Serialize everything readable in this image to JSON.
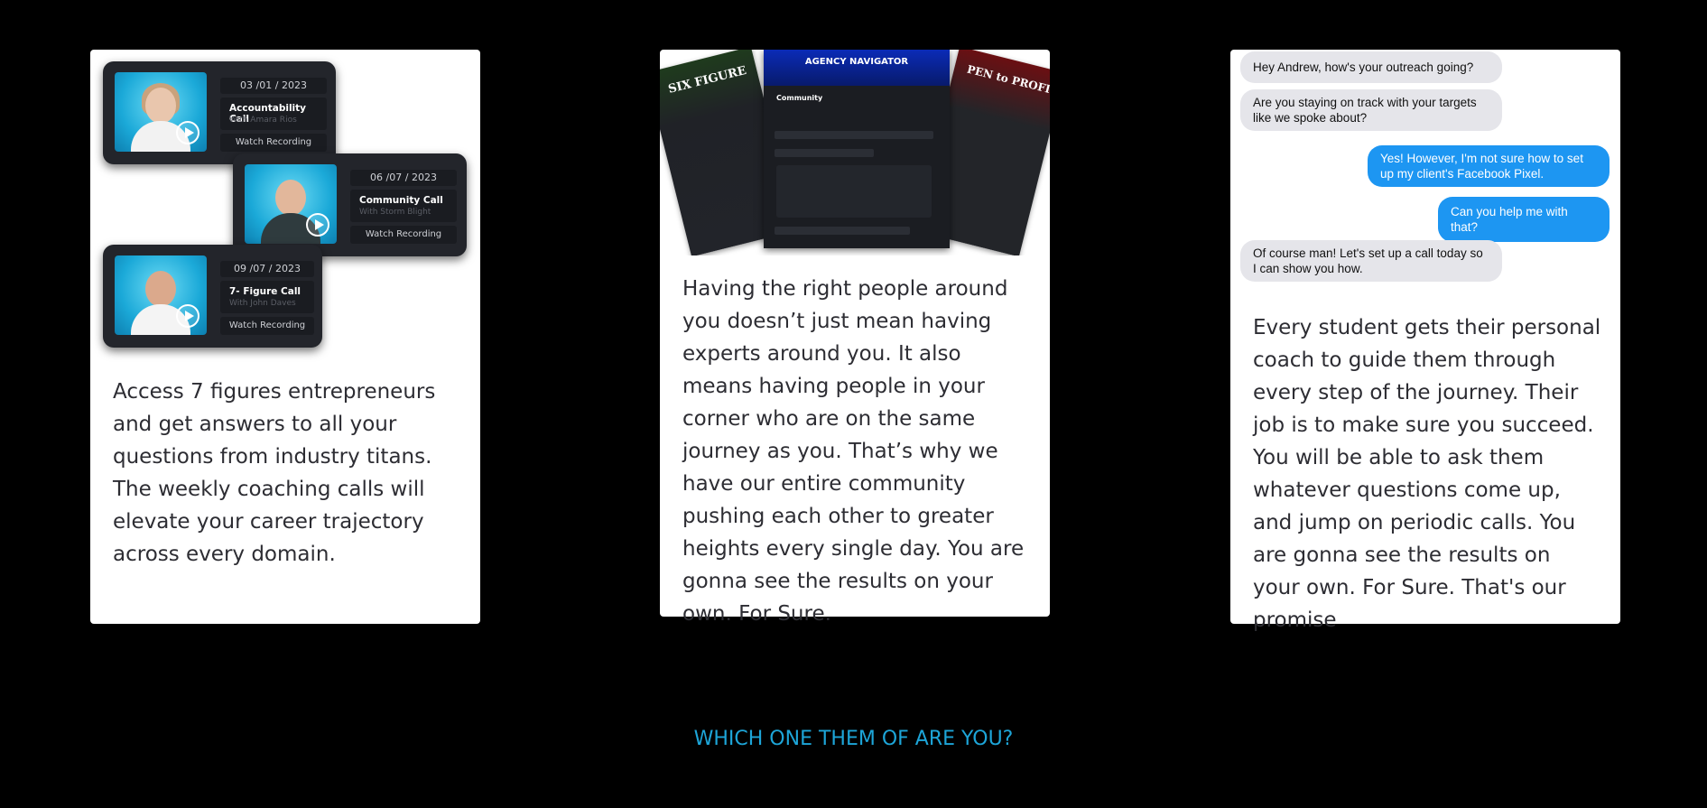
{
  "cards": [
    {
      "text": "Access 7 figures entrepreneurs and get answers to all your questions from industry titans. The weekly coaching calls will elevate your career trajectory across every domain.",
      "recordings": [
        {
          "date": "03 /01 / 2023",
          "title": "Accountability Call",
          "with": "With Amara Rios",
          "watch": "Watch Recording"
        },
        {
          "date": "06 /07 / 2023",
          "title": "Community Call",
          "with": "With Storm Blight",
          "watch": "Watch Recording"
        },
        {
          "date": "09 /07 / 2023",
          "title": "7- Figure Call",
          "with": "With John Daves",
          "watch": "Watch Recording"
        }
      ]
    },
    {
      "text": "Having the right people around you doesn’t just mean having experts around you. It also means having people in your corner who are on the same journey as you. That’s why we have our entire community pushing each other to greater heights every single day. You are gonna see the results on your own. For Sure.",
      "screens": {
        "left_brand": "SIX FIGURE",
        "main_brand": "AGENCY NAVIGATOR",
        "main_section": "Community",
        "right_brand": "PEN to PROFIT"
      }
    },
    {
      "text": "Every student gets their personal coach to guide them through every step of the journey. Their job is to make sure you succeed. You will be able to ask them whatever questions come up, and jump on periodic calls. You are gonna see the results on your own. For Sure. That's our promise",
      "messages": [
        {
          "text": "Hey Andrew, how's your outreach going?"
        },
        {
          "text": "Are you staying on track with your targets like we spoke about?"
        },
        {
          "text": "Yes! However, I'm not sure how to set up my client's Facebook Pixel."
        },
        {
          "text": "Can you help me with that?"
        },
        {
          "text": "Of course man! Let's set up a call today so I can show you how."
        }
      ]
    }
  ],
  "bottom_heading": "WHICH ONE THEM OF ARE YOU?",
  "colors": {
    "background": "#000000",
    "heading": "#1da5d8",
    "sent_bubble": "#1d96f2",
    "received_bubble": "#e5e5ea"
  }
}
